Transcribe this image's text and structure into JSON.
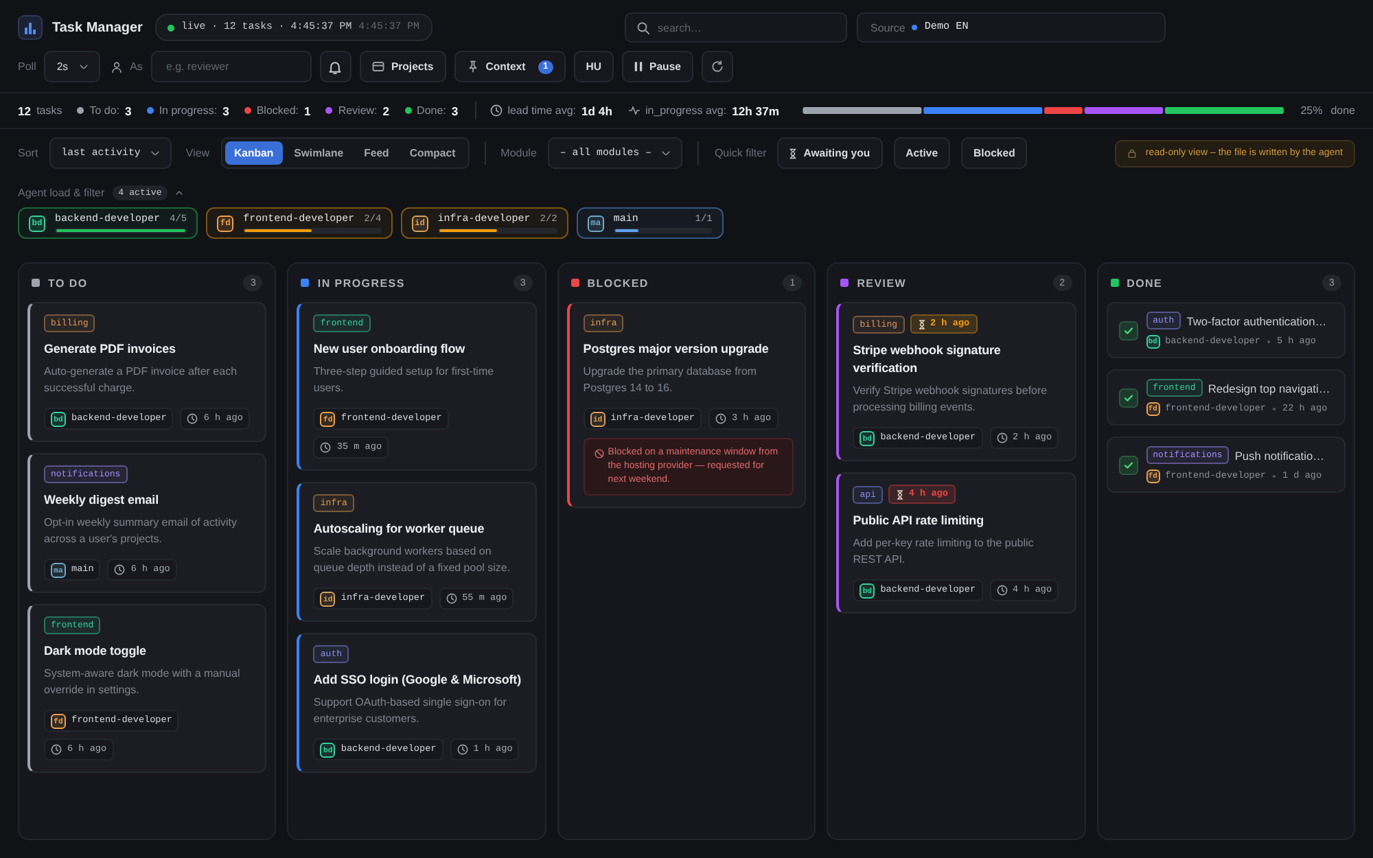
{
  "header": {
    "title": "Task Manager",
    "live": "live · 12 tasks · 4:45:37 PM",
    "live_time": "4:45:37 PM",
    "search": {
      "placeholder": "search…"
    },
    "source": {
      "label": "Source",
      "value": "Demo EN"
    }
  },
  "toolbar": {
    "poll_label": "Poll",
    "poll_value": "2s",
    "as_label": "As",
    "as_placeholder": "e.g. reviewer",
    "projects": "Projects",
    "context": {
      "label": "Context",
      "badge": "1"
    },
    "language": "HU",
    "pause": "Pause"
  },
  "summary": {
    "total": "12",
    "total_label": "tasks",
    "stats": [
      {
        "label": "To do:",
        "value": "3",
        "color": "#9ca3af"
      },
      {
        "label": "In progress:",
        "value": "3",
        "color": "#3b82f6"
      },
      {
        "label": "Blocked:",
        "value": "1",
        "color": "#ef4444"
      },
      {
        "label": "Review:",
        "value": "2",
        "color": "#a855f7"
      },
      {
        "label": "Done:",
        "value": "3",
        "color": "#22c55e"
      }
    ],
    "lead_time": {
      "label": "lead time avg:",
      "value": "1d 4h"
    },
    "in_progress_time": {
      "label": "in_progress avg:",
      "value": "12h 37m"
    },
    "progress": {
      "percent": "25%",
      "label": "done"
    }
  },
  "filters": {
    "sort_label": "Sort",
    "sort_value": "last activity",
    "view_label": "View",
    "views": [
      {
        "label": "Kanban",
        "selected": true
      },
      {
        "label": "Swimlane",
        "selected": false
      },
      {
        "label": "Feed",
        "selected": false
      },
      {
        "label": "Compact",
        "selected": false
      }
    ],
    "module_label": "Module",
    "module_value": "– all modules –",
    "quick_label": "Quick filter",
    "quick": [
      {
        "label": "Awaiting you",
        "kind": "awaiting",
        "selected": false
      },
      {
        "label": "Active",
        "kind": "plain",
        "selected": false
      },
      {
        "label": "Blocked",
        "kind": "plain",
        "selected": false
      }
    ],
    "notice": "read-only view – the file is written by the agent"
  },
  "agents": {
    "label": "Agent load & filter",
    "active": "4 active",
    "expanded": true,
    "items": [
      {
        "avatar": {
          "initials": "bd",
          "color": "#34d399"
        },
        "name": "backend-developer",
        "count": "4/5",
        "level": 1,
        "color": "#22c55e"
      },
      {
        "avatar": {
          "initials": "fd",
          "color": "#f0a04b"
        },
        "name": "frontend-developer",
        "count": "2/4",
        "level": 0.5,
        "color": "#f59e0b"
      },
      {
        "avatar": {
          "initials": "id",
          "color": "#d9a05b"
        },
        "name": "infra-developer",
        "count": "2/2",
        "level": 0.5,
        "color": "#f59e0b"
      },
      {
        "avatar": {
          "initials": "ma",
          "color": "#6ea8c7"
        },
        "name": "main",
        "count": "1/1",
        "level": 0.25,
        "color": "#60a5fa"
      }
    ]
  },
  "columns": [
    {
      "title": "TO DO",
      "count": "3",
      "color": "#9ca3af",
      "kind": "cards",
      "cards": [
        {
          "tag": {
            "text": "billing",
            "color": "#e0965a"
          },
          "title": "Generate PDF invoices",
          "description": "Auto-generate a PDF invoice after each successful charge.",
          "assignee": {
            "initials": "bd",
            "name": "backend-developer",
            "color": "#34d399"
          },
          "time": "6 h ago"
        },
        {
          "tag": {
            "text": "notifications",
            "color": "#a78bfa"
          },
          "title": "Weekly digest email",
          "description": "Opt-in weekly summary email of activity across a user's projects.",
          "assignee": {
            "initials": "ma",
            "name": "main",
            "color": "#6ea8c7"
          },
          "time": "6 h ago"
        },
        {
          "tag": {
            "text": "frontend",
            "color": "#34d399"
          },
          "title": "Dark mode toggle",
          "description": "System-aware dark mode with a manual override in settings.",
          "assignee": {
            "initials": "fd",
            "name": "frontend-developer",
            "color": "#f0a04b"
          },
          "time": "6 h ago"
        }
      ]
    },
    {
      "title": "IN PROGRESS",
      "count": "3",
      "color": "#3b82f6",
      "kind": "cards",
      "cards": [
        {
          "tag": {
            "text": "frontend",
            "color": "#34d399"
          },
          "title": "New user onboarding flow",
          "description": "Three-step guided setup for first-time users.",
          "assignee": {
            "initials": "fd",
            "name": "frontend-developer",
            "color": "#f0a04b"
          },
          "time": "35 m ago"
        },
        {
          "tag": {
            "text": "infra",
            "color": "#e59a4f"
          },
          "title": "Autoscaling for worker queue",
          "description": "Scale background workers based on queue depth instead of a fixed pool size.",
          "assignee": {
            "initials": "id",
            "name": "infra-developer",
            "color": "#d9a05b"
          },
          "time": "55 m ago"
        },
        {
          "tag": {
            "text": "auth",
            "color": "#8b93f8"
          },
          "title": "Add SSO login (Google & Microsoft)",
          "description": "Support OAuth-based single sign-on for enterprise customers.",
          "assignee": {
            "initials": "bd",
            "name": "backend-developer",
            "color": "#34d399"
          },
          "time": "1 h ago"
        }
      ]
    },
    {
      "title": "BLOCKED",
      "count": "1",
      "color": "#ef4444",
      "kind": "cards",
      "cards": [
        {
          "tag": {
            "text": "infra",
            "color": "#e59a4f"
          },
          "title": "Postgres major version upgrade",
          "description": "Upgrade the primary database from Postgres 14 to 16.",
          "assignee": {
            "initials": "id",
            "name": "infra-developer",
            "color": "#d9a05b"
          },
          "time": "3 h ago",
          "note": "Blocked on a maintenance window from the hosting provider — requested for next weekend."
        }
      ]
    },
    {
      "title": "REVIEW",
      "count": "2",
      "color": "#a855f7",
      "kind": "cards",
      "cards": [
        {
          "tag": {
            "text": "billing",
            "color": "#e0965a"
          },
          "waiting": {
            "text": "2 h ago",
            "color": "#f59e0b"
          },
          "title": "Stripe webhook signature verification",
          "description": "Verify Stripe webhook signatures before processing billing events.",
          "assignee": {
            "initials": "bd",
            "name": "backend-developer",
            "color": "#34d399"
          },
          "time": "2 h ago"
        },
        {
          "tag": {
            "text": "api",
            "color": "#818cf8"
          },
          "waiting": {
            "text": "4 h ago",
            "color": "#ef4444"
          },
          "title": "Public API rate limiting",
          "description": "Add per-key rate limiting to the public REST API.",
          "assignee": {
            "initials": "bd",
            "name": "backend-developer",
            "color": "#34d399"
          },
          "time": "4 h ago"
        }
      ]
    },
    {
      "title": "DONE",
      "count": "3",
      "color": "#22c55e",
      "kind": "compact",
      "cards": [
        {
          "tag": {
            "text": "auth",
            "color": "#8b93f8"
          },
          "title": "Two-factor authentication…",
          "assignee": {
            "initials": "bd",
            "name": "backend-developer",
            "color": "#34d399"
          },
          "time": "5 h ago"
        },
        {
          "tag": {
            "text": "frontend",
            "color": "#34d399"
          },
          "title": "Redesign top navigati…",
          "assignee": {
            "initials": "fd",
            "name": "frontend-developer",
            "color": "#f0a04b"
          },
          "time": "22 h ago"
        },
        {
          "tag": {
            "text": "notifications",
            "color": "#a78bfa"
          },
          "title": "Push notificatio…",
          "assignee": {
            "initials": "fd",
            "name": "frontend-developer",
            "color": "#f0a04b"
          },
          "time": "1 d ago"
        }
      ]
    }
  ]
}
